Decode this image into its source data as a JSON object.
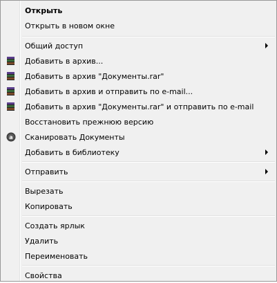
{
  "menu": {
    "items": [
      {
        "label": "Открыть",
        "bold": true
      },
      {
        "label": "Открыть в новом окне"
      },
      {
        "label": "Общий доступ",
        "submenu": true
      },
      {
        "label": "Добавить в архив...",
        "icon": "winrar-icon"
      },
      {
        "label": "Добавить в архив \"Документы.rar\"",
        "icon": "winrar-icon"
      },
      {
        "label": "Добавить в архив и отправить по e-mail...",
        "icon": "winrar-icon"
      },
      {
        "label": "Добавить в архив \"Документы.rar\" и отправить по e-mail",
        "icon": "winrar-icon"
      },
      {
        "label": "Восстановить прежнюю версию"
      },
      {
        "label": "Сканировать Документы",
        "icon": "antivirus-icon"
      },
      {
        "label": "Добавить в библиотеку",
        "submenu": true
      },
      {
        "label": "Отправить",
        "submenu": true
      },
      {
        "label": "Вырезать"
      },
      {
        "label": "Копировать"
      },
      {
        "label": "Создать ярлык"
      },
      {
        "label": "Удалить"
      },
      {
        "label": "Переименовать"
      },
      {
        "label": "Свойства"
      }
    ]
  }
}
